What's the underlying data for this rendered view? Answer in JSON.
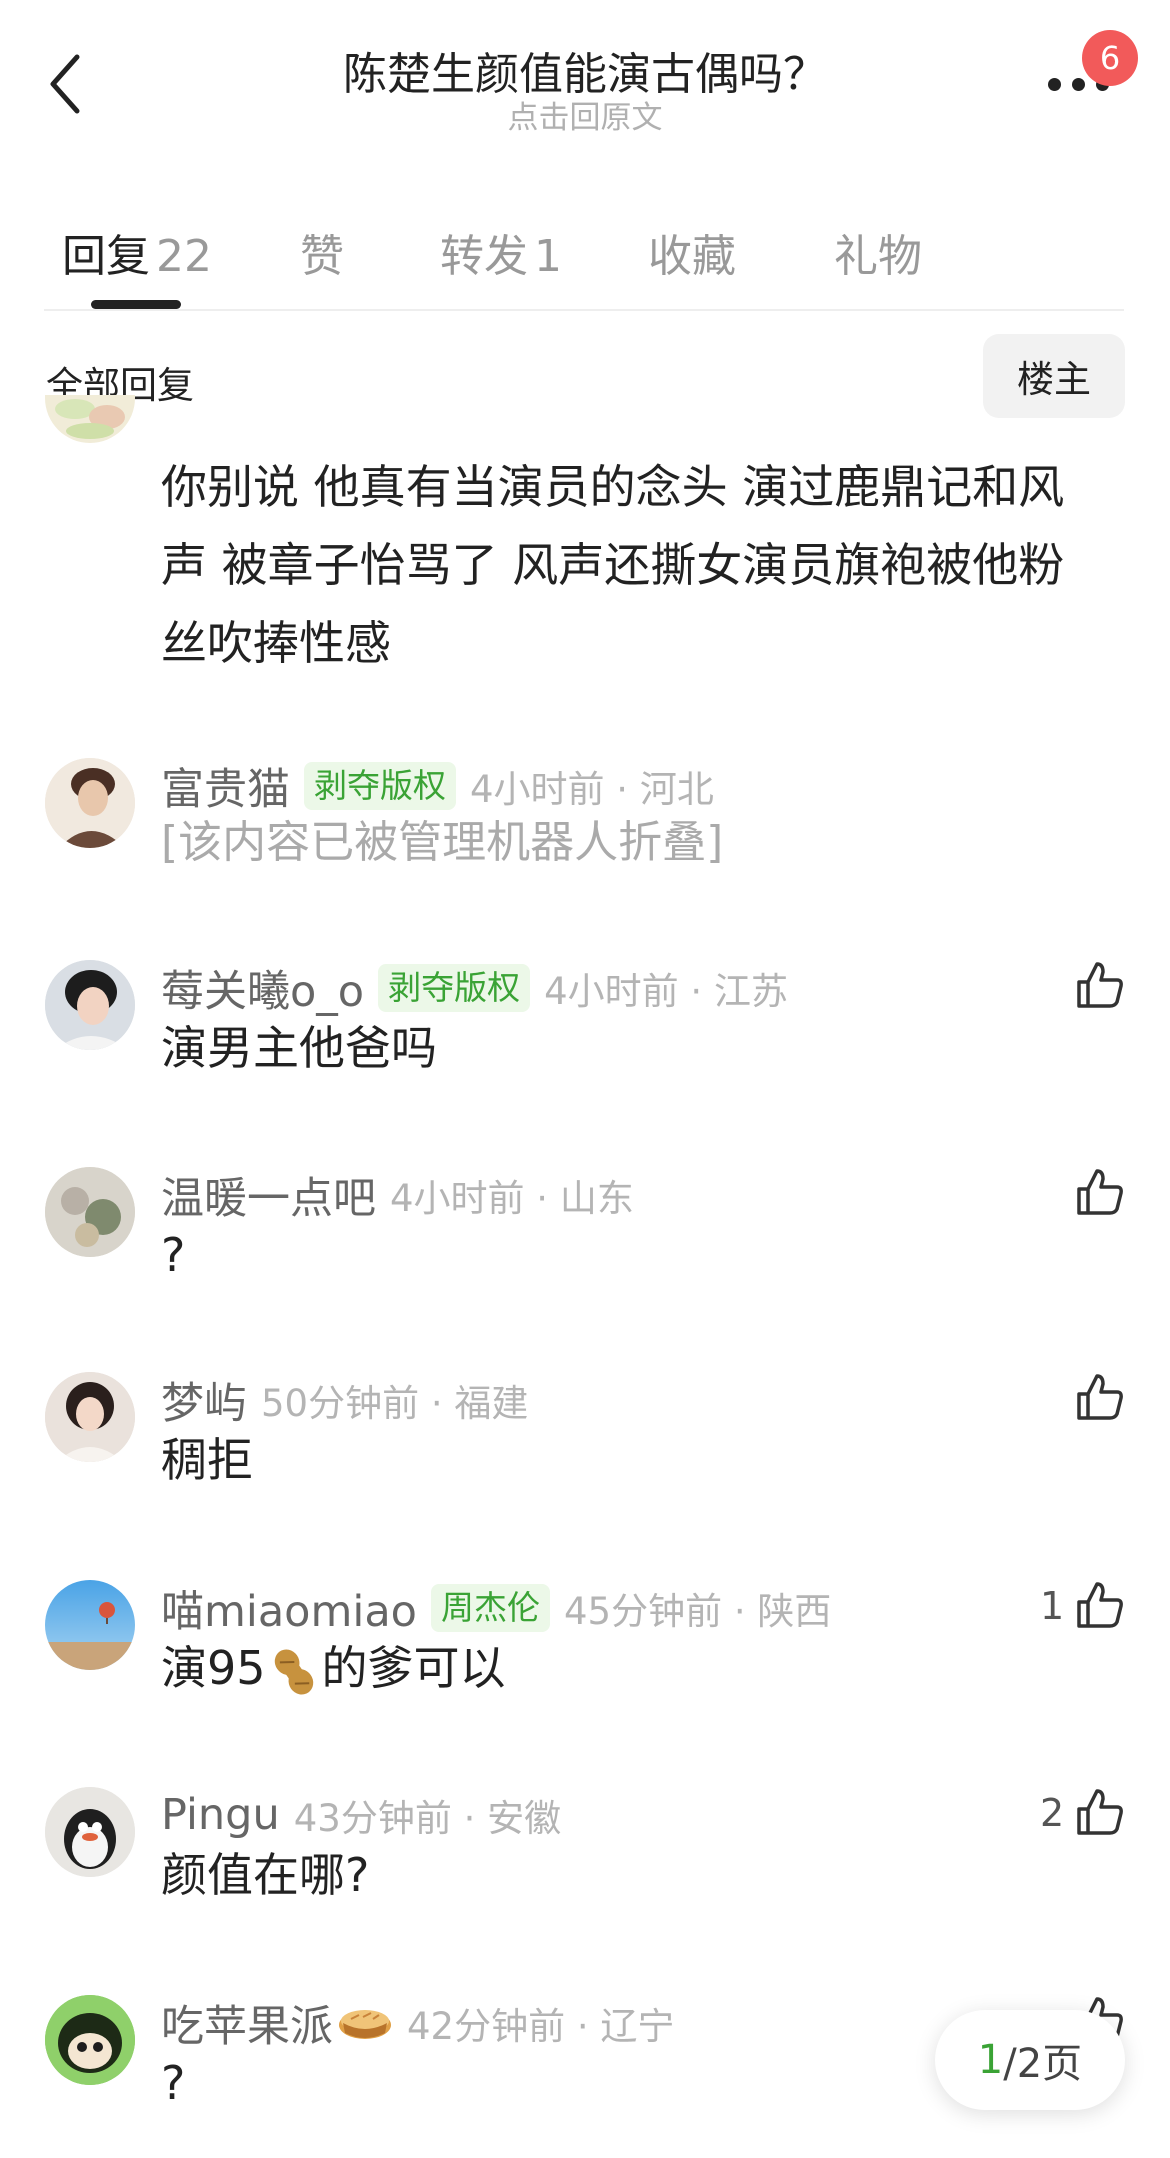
{
  "header": {
    "title": "陈楚生颜值能演古偶吗？",
    "subtitle": "点击回原文",
    "badge_count": "6"
  },
  "tabs": [
    {
      "label": "回复",
      "count": "22",
      "active": true
    },
    {
      "label": "赞",
      "count": ""
    },
    {
      "label": "转发",
      "count": "1"
    },
    {
      "label": "收藏",
      "count": ""
    },
    {
      "label": "礼物",
      "count": ""
    }
  ],
  "section": {
    "title": "全部回复",
    "op_button": "楼主"
  },
  "partial_comment": {
    "lines": [
      "你别说 他真有当演员的念头 演过鹿鼎记和风",
      "声 被章子怡骂了 风声还撕女演员旗袍被他粉",
      "丝吹捧性感"
    ]
  },
  "comments": [
    {
      "username": "富贵猫",
      "tag": "剥夺版权",
      "meta": "4小时前 · 河北",
      "text": "[该内容已被管理机器人折叠]",
      "likes": "",
      "folded": true
    },
    {
      "username": "莓关曦o_o",
      "tag": "剥夺版权",
      "meta": "4小时前 · 江苏",
      "text": "演男主他爸吗",
      "likes": ""
    },
    {
      "username": "温暖一点吧",
      "tag": "",
      "meta": "4小时前 · 山东",
      "text": "?",
      "likes": ""
    },
    {
      "username": "梦屿",
      "tag": "",
      "meta": "50分钟前 · 福建",
      "text": "稠拒",
      "likes": ""
    },
    {
      "username": "喵miaomiao",
      "tag": "周杰伦",
      "meta": "45分钟前 · 陕西",
      "text_before": "演95",
      "emoji": "peanut",
      "text_after": "的爹可以",
      "likes": "1"
    },
    {
      "username": "Pingu",
      "tag": "",
      "meta": "43分钟前 · 安徽",
      "text": "颜值在哪?",
      "likes": "2"
    },
    {
      "username": "吃苹果派",
      "username_emoji": "pie",
      "tag": "",
      "meta": "42分钟前 · 辽宁",
      "text": "?",
      "likes": ""
    }
  ],
  "pager": {
    "current": "1",
    "rest": "/2页"
  },
  "icons": {
    "back": "chevron-left-icon",
    "more": "more-dots-icon",
    "like": "thumbs-up-icon"
  },
  "colors": {
    "accent_green": "#3aa335",
    "badge_red": "#f25a5a",
    "tag_bg": "#ecf8e8"
  }
}
